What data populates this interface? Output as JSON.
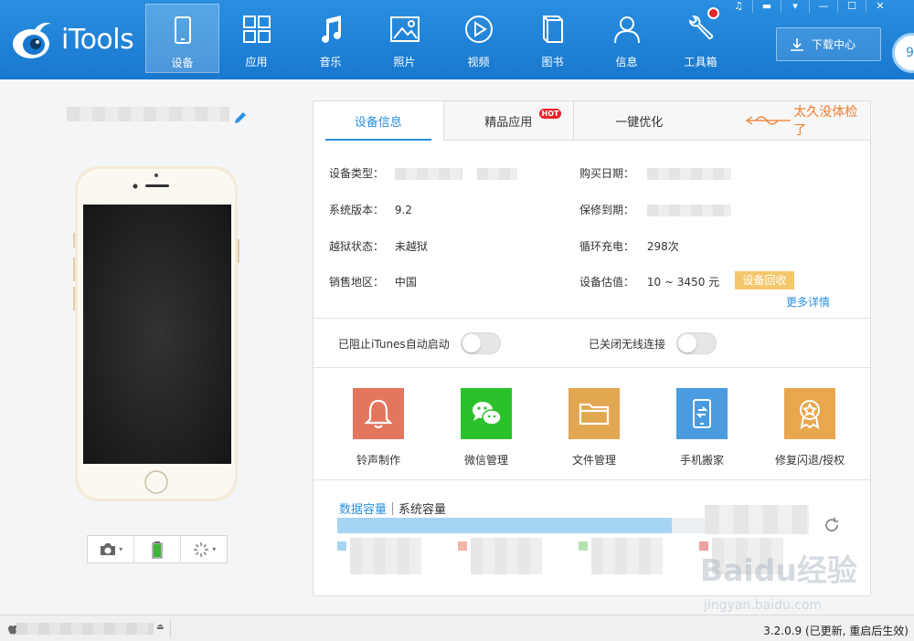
{
  "app": {
    "logo_text": "iTools"
  },
  "nav": [
    {
      "label": "设备",
      "icon": "device-icon",
      "active": true
    },
    {
      "label": "应用",
      "icon": "apps-icon"
    },
    {
      "label": "音乐",
      "icon": "music-icon"
    },
    {
      "label": "照片",
      "icon": "photo-icon"
    },
    {
      "label": "视频",
      "icon": "video-icon"
    },
    {
      "label": "图书",
      "icon": "book-icon"
    },
    {
      "label": "信息",
      "icon": "user-icon"
    },
    {
      "label": "工具箱",
      "icon": "toolbox-icon"
    }
  ],
  "download_button": {
    "label": "下载中心"
  },
  "badge_value": "9",
  "tabs": {
    "device_info": "设备信息",
    "apps": "精品应用",
    "hot": "HOT",
    "optimize": "一键优化",
    "promo": "太久没体检了"
  },
  "info": {
    "device_type_label": "设备类型：",
    "system_version_label": "系统版本：",
    "system_version": "9.2",
    "jailbreak_label": "越狱状态：",
    "jailbreak": "未越狱",
    "region_label": "销售地区：",
    "region": "中国",
    "purchase_date_label": "购买日期：",
    "warranty_label": "保修到期：",
    "charge_cycles_label": "循环充电：",
    "charge_cycles": "298次",
    "valuation_label": "设备估值：",
    "valuation": "10 ~ 3450 元",
    "recycle_button": "设备回收",
    "more_details": "更多详情"
  },
  "toggles": {
    "itunes": "已阻止iTunes自动启动",
    "wifi": "已关闭无线连接"
  },
  "tiles": [
    {
      "label": "铃声制作",
      "icon": "bell-icon",
      "color": "#e4765e"
    },
    {
      "label": "微信管理",
      "icon": "wechat-icon",
      "color": "#2bc12b"
    },
    {
      "label": "文件管理",
      "icon": "folder-icon",
      "color": "#e2a751"
    },
    {
      "label": "手机搬家",
      "icon": "phone-transfer-icon",
      "color": "#4a9be0"
    },
    {
      "label": "修复闪退/授权",
      "icon": "badge-icon",
      "color": "#e8a74c"
    }
  ],
  "capacity": {
    "data_tab": "数据容量",
    "system_tab": "系统容量",
    "used_fraction": 0.74
  },
  "watermark": {
    "logo": "Baidu经验",
    "url": "jingyan.baidu.com"
  },
  "status": {
    "version": "3.2.0.9 (已更新, 重启后生效)"
  },
  "colors": {
    "accent": "#2a8fe0",
    "topbar": "#1f84d8",
    "recycle": "#f5c76d",
    "promo": "#f07a2a"
  }
}
